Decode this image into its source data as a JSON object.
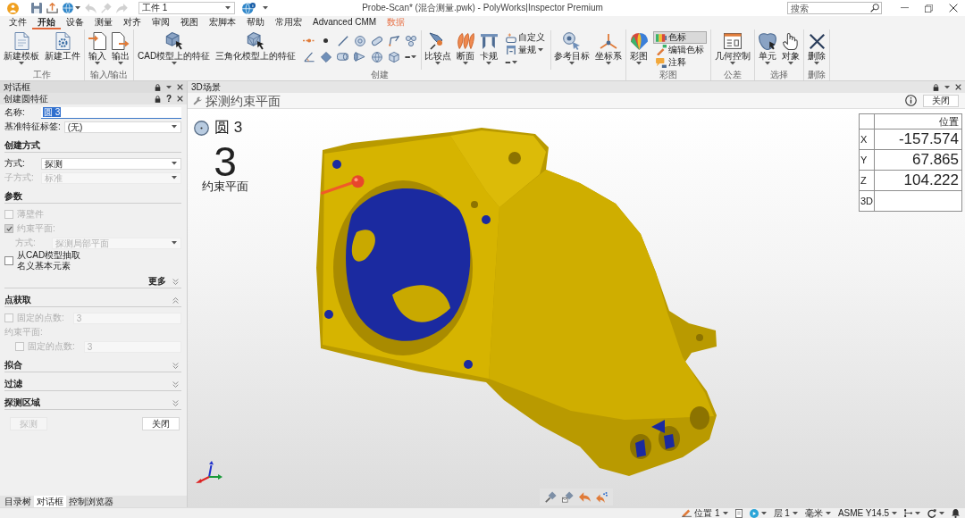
{
  "title_bar": {
    "quick_access": [
      {
        "disabled": false,
        "dropdown": false
      },
      {
        "disabled": false,
        "dropdown": false
      },
      {
        "disabled": false,
        "dropdown": true
      },
      {
        "disabled": true,
        "dropdown": false
      },
      {
        "disabled": true,
        "dropdown": false
      },
      {
        "disabled": true,
        "dropdown": false
      }
    ],
    "workpiece": "工件 1",
    "title": "Probe-Scan* (混合测量.pwk) - PolyWorks|Inspector Premium",
    "search": {
      "placeholder": "搜索"
    }
  },
  "menu_tabs": [
    {
      "label": "文件",
      "selected": false,
      "kind": "normal"
    },
    {
      "label": "开始",
      "selected": true,
      "kind": "normal"
    },
    {
      "label": "设备",
      "selected": false,
      "kind": "normal"
    },
    {
      "label": "测量",
      "selected": false,
      "kind": "normal"
    },
    {
      "label": "对齐",
      "selected": false,
      "kind": "normal"
    },
    {
      "label": "审阅",
      "selected": false,
      "kind": "normal"
    },
    {
      "label": "视图",
      "selected": false,
      "kind": "normal"
    },
    {
      "label": "宏脚本",
      "selected": false,
      "kind": "normal"
    },
    {
      "label": "帮助",
      "selected": false,
      "kind": "normal"
    },
    {
      "label": "常用宏",
      "selected": false,
      "kind": "normal"
    },
    {
      "label": "Advanced CMM",
      "selected": false,
      "kind": "normal"
    },
    {
      "label": "数据",
      "selected": false,
      "kind": "contextual"
    }
  ],
  "ribbon": [
    {
      "label": "工作",
      "sections": [
        [
          {
            "kind": "large",
            "label": "新建模板",
            "dropdown": true
          },
          {
            "kind": "large",
            "label": "新建工件",
            "dropdown": false
          }
        ]
      ]
    },
    {
      "label": "输入/输出",
      "sections": [
        [
          {
            "kind": "large",
            "label": "输入",
            "dropdown": true
          },
          {
            "kind": "large",
            "label": "输出",
            "dropdown": true
          }
        ]
      ]
    },
    {
      "label": "创建",
      "sections": [
        [
          {
            "kind": "large",
            "label": "CAD模型上的特征",
            "dropdown": true
          },
          {
            "kind": "large",
            "label": "三角化模型上的特征",
            "dropdown": false
          },
          {
            "kind": "icon"
          },
          {
            "kind": "icon"
          },
          {
            "kind": "icon"
          },
          {
            "kind": "icon"
          },
          {
            "kind": "icon"
          },
          {
            "kind": "icon"
          },
          {
            "kind": "icon"
          },
          {
            "kind": "icon"
          },
          {
            "kind": "icon"
          },
          {
            "kind": "icon"
          },
          {
            "kind": "icon"
          },
          {
            "kind": "icon"
          },
          {
            "kind": "icon"
          },
          {
            "kind": "more",
            "label": "•••",
            "dropdown": true
          }
        ],
        [
          {
            "kind": "large",
            "label": "比较点",
            "dropdown": true
          },
          {
            "kind": "large",
            "label": "断面",
            "dropdown": true
          },
          {
            "kind": "large",
            "label": "卡规",
            "dropdown": true
          },
          {
            "kind": "small",
            "label": "自定义",
            "dropdown": false
          },
          {
            "kind": "small",
            "label": "量规",
            "dropdown": true
          },
          {
            "kind": "more",
            "label": "•••",
            "dropdown": true
          }
        ],
        [
          {
            "kind": "large",
            "label": "参考目标",
            "dropdown": true
          },
          {
            "kind": "large",
            "label": "坐标系",
            "dropdown": true
          }
        ]
      ]
    },
    {
      "label": "彩图",
      "sections": [
        [
          {
            "kind": "large",
            "label": "彩图",
            "dropdown": true
          },
          {
            "kind": "small",
            "label": "色标",
            "dropdown": false,
            "on": true
          },
          {
            "kind": "small",
            "label": "编辑色标",
            "dropdown": false,
            "on": false
          },
          {
            "kind": "small",
            "label": "注释",
            "dropdown": false,
            "on": false
          }
        ]
      ]
    },
    {
      "label": "公差",
      "sections": [
        [
          {
            "kind": "large",
            "label": "几何控制",
            "dropdown": true
          }
        ]
      ]
    },
    {
      "label": "选择",
      "sections": [
        [
          {
            "kind": "large",
            "label": "单元",
            "dropdown": true
          },
          {
            "kind": "large",
            "label": "对象",
            "dropdown": true
          }
        ]
      ]
    },
    {
      "label": "删除",
      "sections": [
        [
          {
            "kind": "large",
            "label": "删除",
            "dropdown": true
          }
        ]
      ]
    }
  ],
  "dialog": {
    "pane_title": "对话框",
    "title": "创建圆特征",
    "help": "?",
    "rows": [
      {
        "kind": "text_field",
        "label": "名称:",
        "value": "圆 3",
        "value_selected": true
      },
      {
        "kind": "dropdown",
        "label": "基准特征标签:",
        "value": "(无)",
        "disabled": false
      },
      {
        "kind": "section",
        "label": "创建方式",
        "rows": [
          {
            "kind": "dropdown",
            "label": "方式:",
            "value": "探测",
            "disabled": false
          },
          {
            "kind": "dropdown",
            "label": "子方式:",
            "value": "标准",
            "disabled": true
          }
        ]
      },
      {
        "kind": "section",
        "label": "参数",
        "rows": [
          {
            "kind": "checkbox",
            "label": "薄壁件",
            "checked": false,
            "disabled": true
          },
          {
            "kind": "checkbox",
            "label": "约束平面:",
            "checked": true,
            "disabled": true,
            "children": [
              {
                "kind": "dropdown",
                "label": "方式:",
                "value": "探测局部平面",
                "disabled": true
              }
            ]
          },
          {
            "kind": "checkbox",
            "label": "从CAD模型抽取名义基本元素",
            "checked": false,
            "disabled": false
          }
        ],
        "more": {
          "label": "更多",
          "expanded": false
        }
      },
      {
        "kind": "collapsible_section",
        "label": "点获取",
        "expanded": true,
        "rows": [
          {
            "kind": "checkbox",
            "label": "固定的点数:",
            "checked": false,
            "disabled": true,
            "value": "3"
          },
          {
            "kind": "label",
            "label": "约束平面:",
            "disabled": true,
            "children": [
              {
                "kind": "checkbox",
                "label": "固定的点数:",
                "checked": false,
                "disabled": true,
                "value": "3"
              }
            ]
          }
        ]
      },
      {
        "kind": "collapsible_section",
        "label": "拟合",
        "expanded": false
      },
      {
        "kind": "collapsible_section",
        "label": "过滤",
        "expanded": false
      },
      {
        "kind": "collapsible_section",
        "label": "探测区域",
        "expanded": false
      }
    ],
    "buttons": [
      {
        "label": "探测",
        "disabled": true
      },
      {
        "label": "关闭",
        "disabled": false
      }
    ],
    "bottom_tabs": [
      {
        "label": "目录树",
        "selected": false
      },
      {
        "label": "对话框",
        "selected": true
      },
      {
        "label": "控制浏览器",
        "selected": false
      }
    ]
  },
  "scene": {
    "pane_title": "3D场景",
    "mode": {
      "title": "探测约束平面",
      "close": "关闭"
    },
    "feature": "圆 3",
    "step": {
      "number": "3",
      "label": "约束平面"
    },
    "position_table": {
      "header": "位置",
      "rows": [
        {
          "axis": "X",
          "value": "-157.574"
        },
        {
          "axis": "Y",
          "value": "67.865"
        },
        {
          "axis": "Z",
          "value": "104.222"
        },
        {
          "axis": "3D"
        }
      ]
    }
  },
  "status_bar": [
    {
      "kind": "icon_text",
      "label": "位置 1",
      "dropdown": true
    },
    {
      "kind": "icon",
      "dropdown": false
    },
    {
      "kind": "icon",
      "dropdown": true
    },
    {
      "kind": "text",
      "label": "层 1",
      "dropdown": true
    },
    {
      "kind": "text",
      "label": "毫米",
      "dropdown": true
    },
    {
      "kind": "text",
      "label": "ASME Y14.5",
      "dropdown": true
    },
    {
      "kind": "icon",
      "dropdown": true
    },
    {
      "kind": "icon",
      "dropdown": true
    },
    {
      "kind": "icon",
      "dropdown": false
    }
  ]
}
